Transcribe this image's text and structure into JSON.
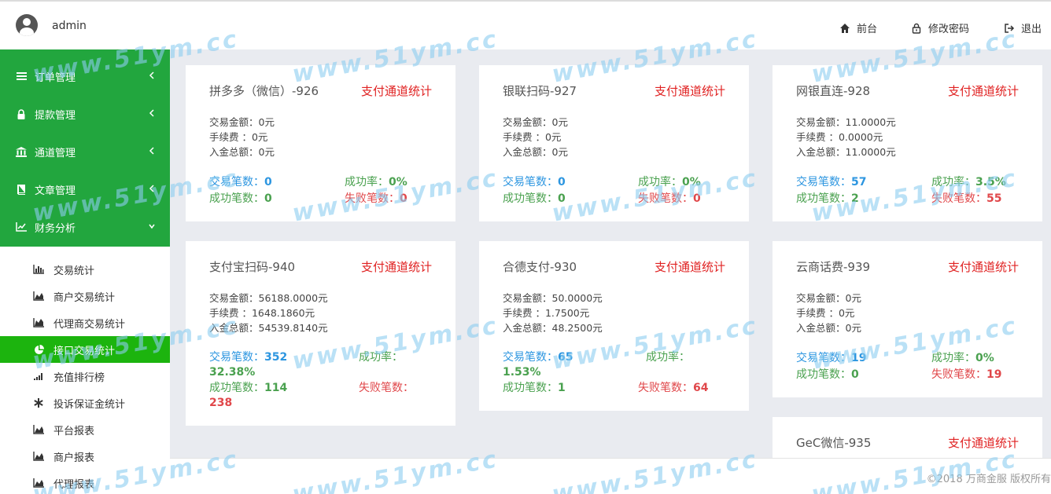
{
  "header": {
    "username": "admin",
    "links": [
      "前台",
      "修改密码",
      "退出"
    ]
  },
  "sidebar": {
    "menu": [
      {
        "label": "订单管理"
      },
      {
        "label": "提款管理"
      },
      {
        "label": "通道管理"
      },
      {
        "label": "文章管理"
      },
      {
        "label": "财务分析"
      }
    ],
    "submenu": [
      {
        "label": "交易统计"
      },
      {
        "label": "商户交易统计"
      },
      {
        "label": "代理商交易统计"
      },
      {
        "label": "接口交易统计"
      },
      {
        "label": "充值排行榜"
      },
      {
        "label": "投诉保证金统计"
      },
      {
        "label": "平台报表"
      },
      {
        "label": "商户报表"
      },
      {
        "label": "代理报表"
      }
    ]
  },
  "labels": {
    "amount": "交易金额：",
    "fee": "手续费   ：",
    "income": "入金总额：",
    "count": "交易笔数：",
    "rate": "成功率：",
    "success": "成功笔数：",
    "fail": "失败笔数：",
    "stats_link": "支付通道统计"
  },
  "cards": [
    {
      "title": "拼多多（微信）-926",
      "amount": "0元",
      "fee": "0元",
      "income": "0元",
      "count": "0",
      "rate": "0%",
      "success": "0",
      "fail": "0"
    },
    {
      "title": "银联扫码-927",
      "amount": "0元",
      "fee": "0元",
      "income": "0元",
      "count": "0",
      "rate": "0%",
      "success": "0",
      "fail": "0"
    },
    {
      "title": "网银直连-928",
      "amount": "11.0000元",
      "fee": "0.0000元",
      "income": "11.0000元",
      "count": "57",
      "rate": "3.5%",
      "success": "2",
      "fail": "55"
    },
    {
      "title": "支付宝扫码-940",
      "amount": "56188.0000元",
      "fee": "1648.1860元",
      "income": "54539.8140元",
      "count": "352",
      "rate": "32.38%",
      "success": "114",
      "fail": "238"
    },
    {
      "title": "合德支付-930",
      "amount": "50.0000元",
      "fee": "1.7500元",
      "income": "48.2500元",
      "count": "65",
      "rate": "1.53%",
      "success": "1",
      "fail": "64"
    },
    {
      "title": "云商话费-939",
      "amount": "0元",
      "fee": "0元",
      "income": "0元",
      "count": "19",
      "rate": "0%",
      "success": "0",
      "fail": "19"
    },
    {
      "title": "GeC微信-935"
    }
  ],
  "footer": {
    "copyright": "©2018 万商金服 版权所有"
  },
  "watermark": "www.51ym.cc"
}
